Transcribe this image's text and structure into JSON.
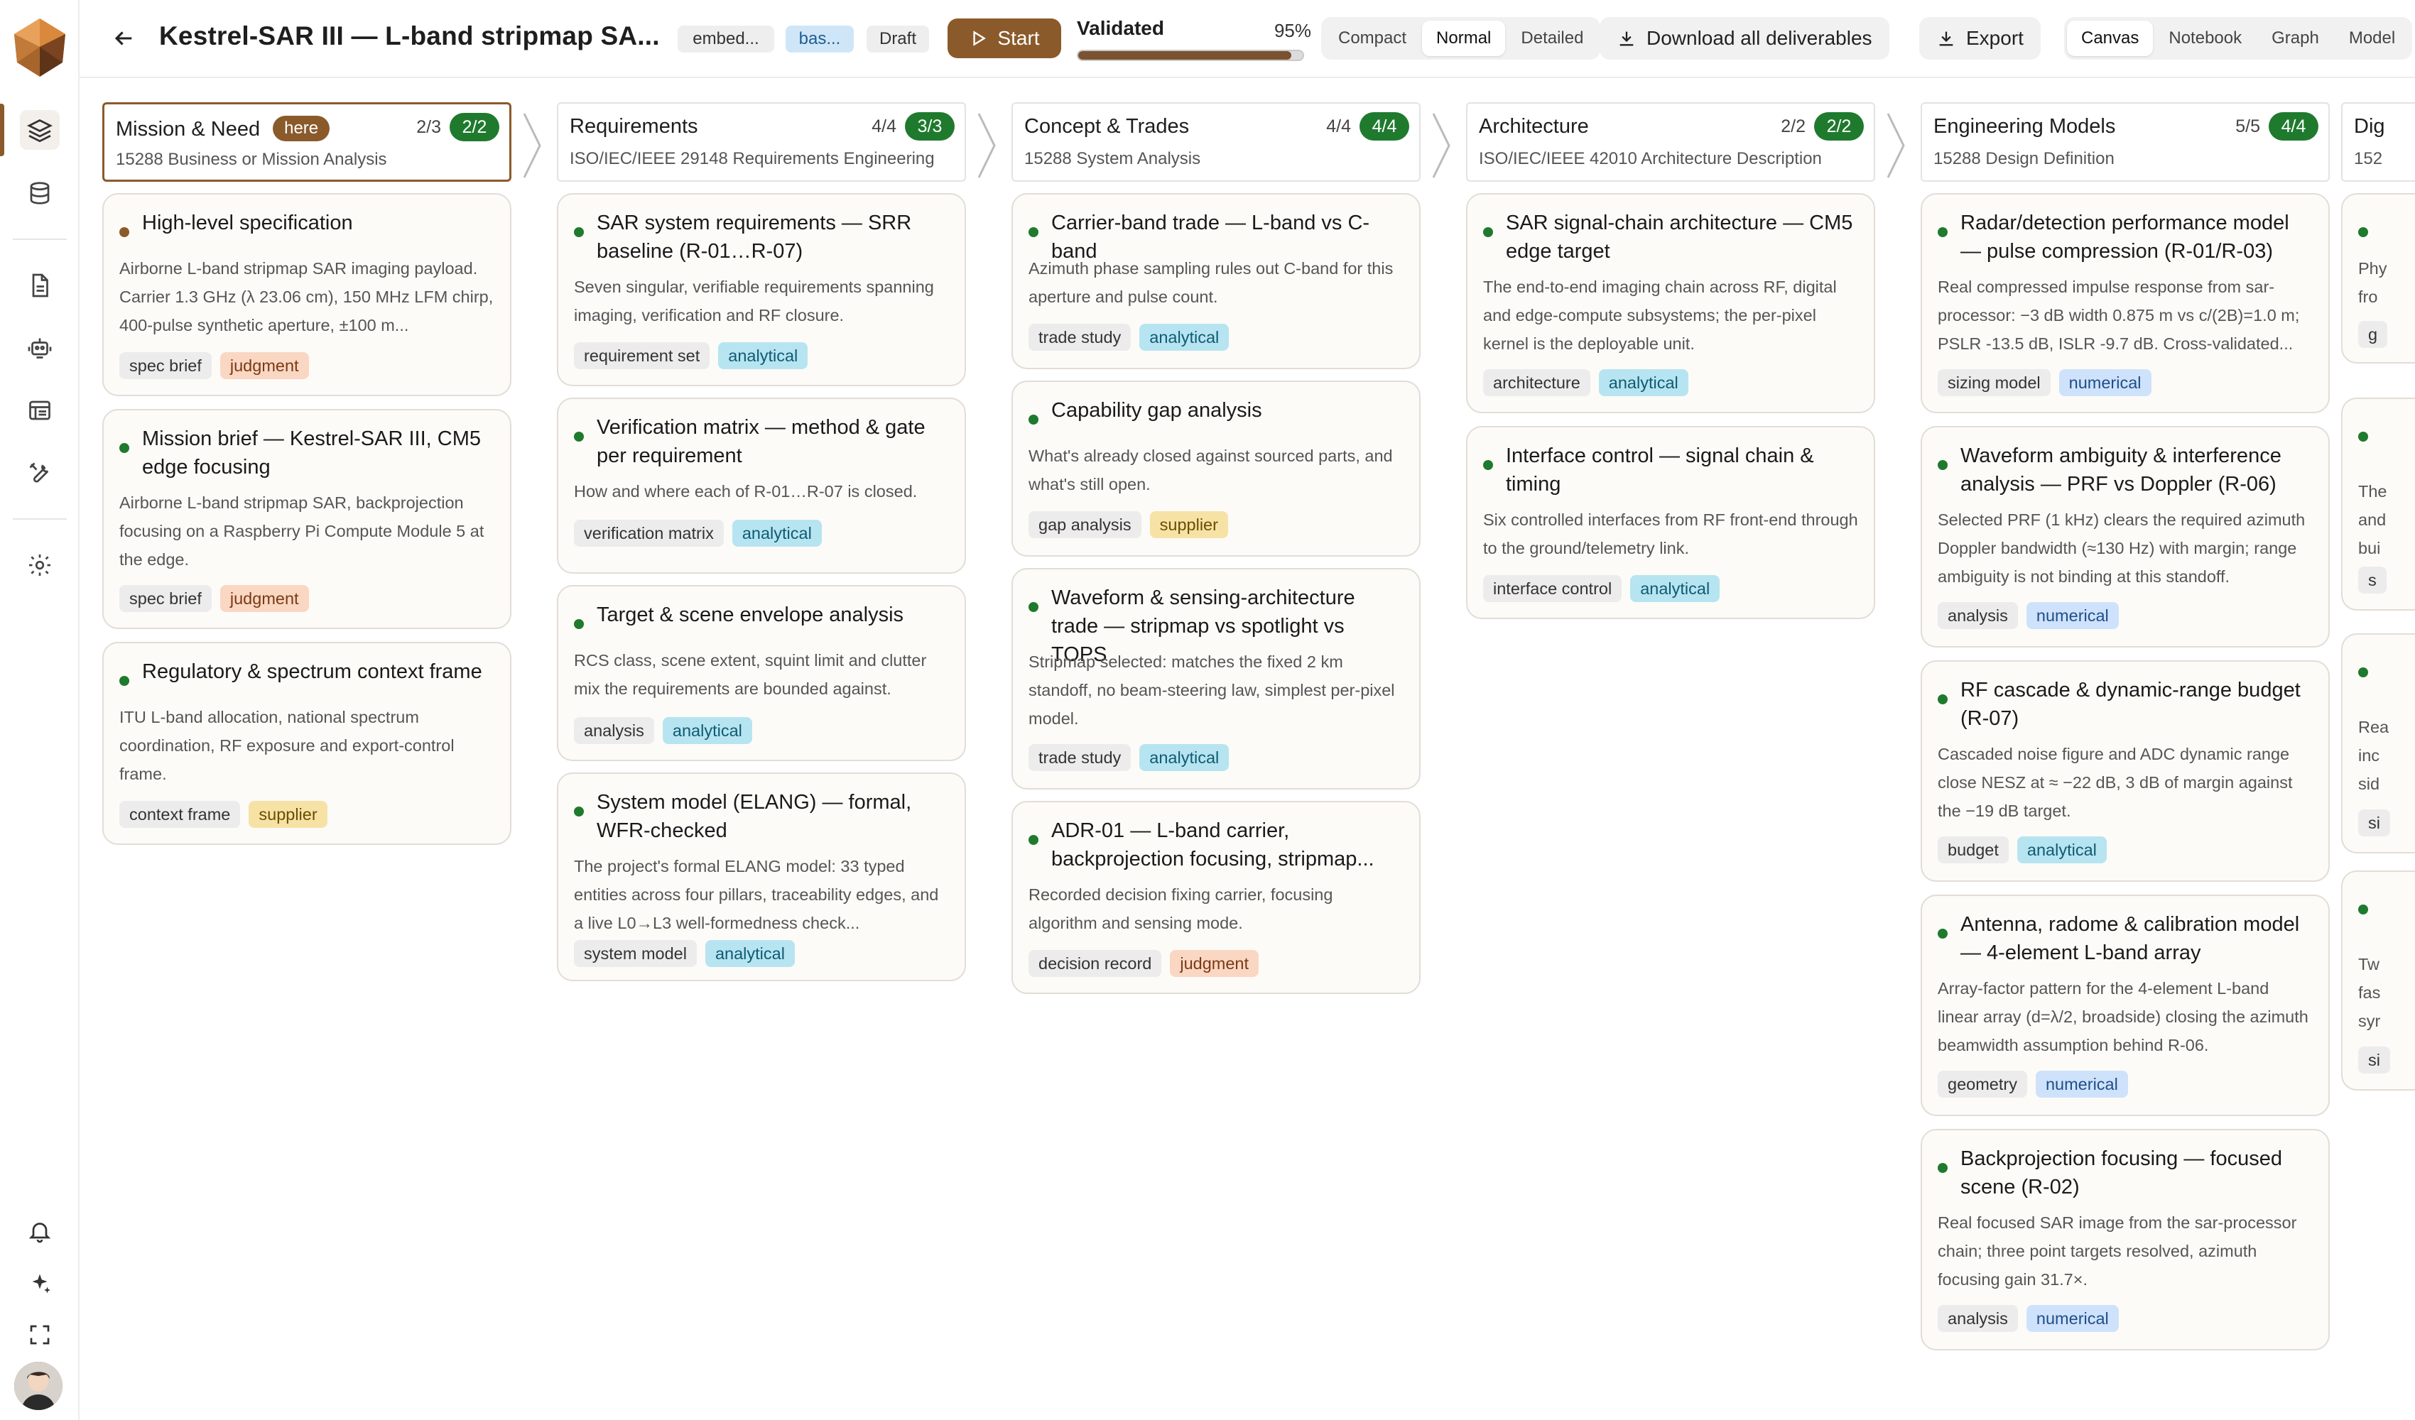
{
  "header": {
    "title": "Kestrel-SAR III — L-band stripmap SA...",
    "chips": [
      "embed...",
      "bas...",
      "Draft"
    ],
    "start_label": "Start",
    "validated_label": "Validated",
    "validated_pct": "95%",
    "validated_value": 95,
    "density": [
      "Compact",
      "Normal",
      "Detailed"
    ],
    "density_selected": "Normal",
    "download_label": "Download all deliverables",
    "export_label": "Export",
    "views": [
      "Canvas",
      "Notebook",
      "Graph",
      "Model"
    ],
    "view_selected": "Canvas"
  },
  "rail": {
    "icons": [
      "layers-icon",
      "database-icon",
      "document-icon",
      "robot-icon",
      "board-icon",
      "tools-icon",
      "gear-icon",
      "bell-icon",
      "sparkle-icon",
      "expand-icon"
    ]
  },
  "columns": [
    {
      "name": "Mission & Need",
      "here": "here",
      "count": "2/3",
      "badge": "2/2",
      "standard": "15288 Business or Mission Analysis",
      "cards": [
        {
          "title": "High-level specification",
          "desc": "Airborne L-band stripmap SAR imaging payload. Carrier 1.3 GHz (λ 23.06 cm), 150 MHz LFM chirp, 400-pulse synthetic aperture, ±100 m...",
          "tags": [
            "spec brief",
            "judgment"
          ]
        },
        {
          "title": "Mission brief — Kestrel-SAR III, CM5 edge focusing",
          "desc": "Airborne L-band stripmap SAR, backprojection focusing on a Raspberry Pi Compute Module 5 at the edge.",
          "tags": [
            "spec brief",
            "judgment"
          ]
        },
        {
          "title": "Regulatory & spectrum context frame",
          "desc": "ITU L-band allocation, national spectrum coordination, RF exposure and export-control frame.",
          "tags": [
            "context frame",
            "supplier"
          ]
        }
      ]
    },
    {
      "name": "Requirements",
      "count": "4/4",
      "badge": "3/3",
      "standard": "ISO/IEC/IEEE 29148 Requirements Engineering",
      "cards": [
        {
          "title": "SAR system requirements — SRR baseline (R-01…R-07)",
          "desc": "Seven singular, verifiable requirements spanning imaging, verification and RF closure.",
          "tags": [
            "requirement set",
            "analytical"
          ]
        },
        {
          "title": "Verification matrix — method & gate per requirement",
          "desc": "How and where each of R-01…R-07 is closed.",
          "tags": [
            "verification matrix",
            "analytical"
          ]
        },
        {
          "title": "Target & scene envelope analysis",
          "desc": "RCS class, scene extent, squint limit and clutter mix the requirements are bounded against.",
          "tags": [
            "analysis",
            "analytical"
          ]
        },
        {
          "title": "System model (ELANG) — formal, WFR-checked",
          "desc": "The project's formal ELANG model: 33 typed entities across four pillars, traceability edges, and a live L0→L3 well-formedness check...",
          "tags": [
            "system model",
            "analytical"
          ]
        }
      ]
    },
    {
      "name": "Concept & Trades",
      "count": "4/4",
      "badge": "4/4",
      "standard": "15288 System Analysis",
      "cards": [
        {
          "title": "Carrier-band trade — L-band vs C-band",
          "desc": "Azimuth phase sampling rules out C-band for this aperture and pulse count.",
          "tags": [
            "trade study",
            "analytical"
          ]
        },
        {
          "title": "Capability gap analysis",
          "desc": "What's already closed against sourced parts, and what's still open.",
          "tags": [
            "gap analysis",
            "supplier"
          ]
        },
        {
          "title": "Waveform & sensing-architecture trade — stripmap vs spotlight vs TOPS",
          "desc": "Stripmap selected: matches the fixed 2 km standoff, no beam-steering law, simplest per-pixel model.",
          "tags": [
            "trade study",
            "analytical"
          ]
        },
        {
          "title": "ADR-01 — L-band carrier, backprojection focusing, stripmap...",
          "desc": "Recorded decision fixing carrier, focusing algorithm and sensing mode.",
          "tags": [
            "decision record",
            "judgment"
          ]
        }
      ]
    },
    {
      "name": "Architecture",
      "count": "2/2",
      "badge": "2/2",
      "standard": "ISO/IEC/IEEE 42010 Architecture Description",
      "cards": [
        {
          "title": "SAR signal-chain architecture — CM5 edge target",
          "desc": "The end-to-end imaging chain across RF, digital and edge-compute subsystems; the per-pixel kernel is the deployable unit.",
          "tags": [
            "architecture",
            "analytical"
          ]
        },
        {
          "title": "Interface control — signal chain & timing",
          "desc": "Six controlled interfaces from RF front-end through to the ground/telemetry link.",
          "tags": [
            "interface control",
            "analytical"
          ]
        }
      ]
    },
    {
      "name": "Engineering Models",
      "count": "5/5",
      "badge": "4/4",
      "standard": "15288 Design Definition",
      "cards": [
        {
          "title": "Radar/detection performance model — pulse compression (R-01/R-03)",
          "desc": "Real compressed impulse response from sar-processor: −3 dB width 0.875 m vs c/(2B)=1.0 m; PSLR -13.5 dB, ISLR -9.7 dB. Cross-validated...",
          "tags": [
            "sizing model",
            "numerical"
          ]
        },
        {
          "title": "Waveform ambiguity & interference analysis — PRF vs Doppler (R-06)",
          "desc": "Selected PRF (1 kHz) clears the required azimuth Doppler bandwidth (≈130 Hz) with margin; range ambiguity is not binding at this standoff.",
          "tags": [
            "analysis",
            "numerical"
          ]
        },
        {
          "title": "RF cascade & dynamic-range budget (R-07)",
          "desc": "Cascaded noise figure and ADC dynamic range close NESZ at ≈ −22 dB, 3 dB of margin against the −19 dB target.",
          "tags": [
            "budget",
            "analytical"
          ]
        },
        {
          "title": "Antenna, radome & calibration model — 4-element L-band array",
          "desc": "Array-factor pattern for the 4-element L-band linear array (d=λ/2, broadside) closing the azimuth beamwidth assumption behind R-06.",
          "tags": [
            "geometry",
            "numerical"
          ]
        },
        {
          "title": "Backprojection focusing — focused scene (R-02)",
          "desc": "Real focused SAR image from the sar-processor chain; three point targets resolved, azimuth focusing gain 31.7×.",
          "tags": [
            "analysis",
            "numerical"
          ]
        }
      ]
    },
    {
      "name": "Dig",
      "standard": "152",
      "cards": [
        {
          "title": "",
          "desc": "Phy fro",
          "tags": [
            "g"
          ]
        },
        {
          "title": "",
          "desc": "The and bui",
          "tags": [
            "s"
          ]
        },
        {
          "title": "",
          "desc": "Rea inc sid",
          "tags": [
            "si"
          ]
        },
        {
          "title": "",
          "desc": "Tw fas syr",
          "tags": [
            "si"
          ]
        }
      ]
    }
  ],
  "colors": {
    "accent": "#8b5a2b",
    "success": "#1f7a2e"
  }
}
